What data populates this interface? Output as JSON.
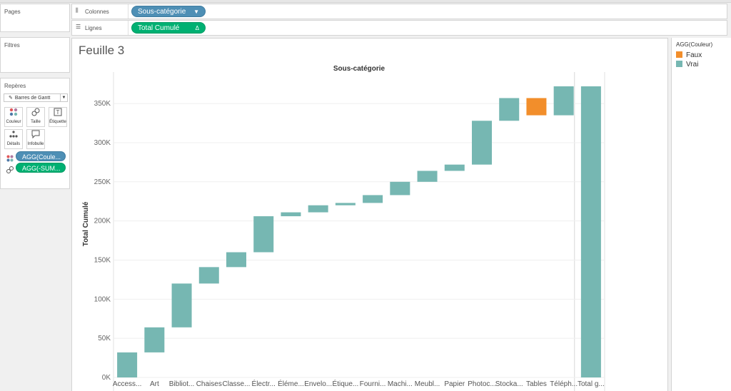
{
  "pages_panel": {
    "title": "Pages"
  },
  "filters_panel": {
    "title": "Filtres"
  },
  "marks_panel": {
    "title": "Repères",
    "mark_type": "Barres de Gantt",
    "buttons": [
      {
        "label": "Couleur",
        "icon": "color-dots-icon"
      },
      {
        "label": "Taille",
        "icon": "size-icon"
      },
      {
        "label": "Étiquette",
        "icon": "label-t-icon"
      },
      {
        "label": "Détails",
        "icon": "detail-dots-icon"
      },
      {
        "label": "Infobulle",
        "icon": "tooltip-icon"
      }
    ],
    "pills": [
      {
        "label": "AGG(Coule...",
        "icon": "color-dots-icon",
        "color": "#4e8fb5"
      },
      {
        "label": "AGG(-SUM...",
        "icon": "size-icon",
        "color": "#00b072"
      }
    ]
  },
  "shelves": {
    "columns": {
      "label": "Colonnes",
      "pill": "Sous-catégorie"
    },
    "rows": {
      "label": "Lignes",
      "pill": "Total Cumulé",
      "pill_tail": "Δ"
    }
  },
  "sheet": {
    "title": "Feuille 3"
  },
  "legend": {
    "title": "AGG(Couleur)",
    "items": [
      {
        "label": "Faux",
        "color": "#f28e2b"
      },
      {
        "label": "Vrai",
        "color": "#76b7b2"
      }
    ]
  },
  "chart_data": {
    "type": "bar",
    "subtype": "waterfall-gantt",
    "title": "Sous-catégorie",
    "xlabel": "Sous-catégorie",
    "ylabel": "Total Cumulé",
    "ylim": [
      0,
      372000
    ],
    "yticks": [
      "0K",
      "50K",
      "100K",
      "150K",
      "200K",
      "250K",
      "300K",
      "350K"
    ],
    "categories": [
      "Access...",
      "Art",
      "Bibliot...",
      "Chaises",
      "Classe...",
      "Électr...",
      "Éléme...",
      "Envelo...",
      "Étique...",
      "Fourni...",
      "Machi...",
      "Meubl...",
      "Papier",
      "Photoc...",
      "Stocka...",
      "Tables",
      "Téléph...",
      "Total g..."
    ],
    "series": [
      {
        "name": "start",
        "values": [
          0,
          32000,
          64000,
          120000,
          141000,
          160000,
          206000,
          211000,
          220000,
          223000,
          233000,
          250000,
          264000,
          272000,
          328000,
          335000,
          335000,
          0
        ]
      },
      {
        "name": "end",
        "values": [
          32000,
          64000,
          120000,
          141000,
          160000,
          206000,
          211000,
          220000,
          223000,
          233000,
          250000,
          264000,
          272000,
          328000,
          357000,
          357000,
          372000,
          372000
        ]
      }
    ],
    "colors": [
      "Vrai",
      "Vrai",
      "Vrai",
      "Vrai",
      "Vrai",
      "Vrai",
      "Vrai",
      "Vrai",
      "Vrai",
      "Vrai",
      "Vrai",
      "Vrai",
      "Vrai",
      "Vrai",
      "Vrai",
      "Faux",
      "Vrai",
      "Vrai"
    ],
    "grid": true
  }
}
